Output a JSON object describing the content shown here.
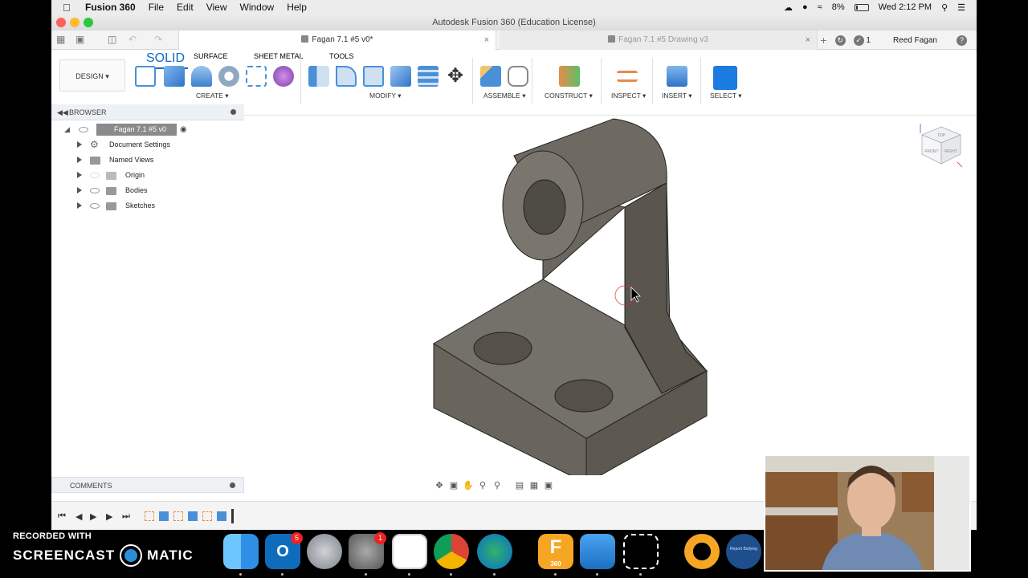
{
  "menubar": {
    "app": "Fusion 360",
    "items": [
      "File",
      "Edit",
      "View",
      "Window",
      "Help"
    ],
    "battery": "8%",
    "clock": "Wed 2:12 PM"
  },
  "window_title": "Autodesk Fusion 360 (Education License)",
  "tabs": {
    "active": "Fagan 7.1 #5 v0*",
    "inactive": "Fagan 7.1 #5 Drawing v3"
  },
  "user": {
    "job_count": "1",
    "name": "Reed Fagan",
    "help": "?"
  },
  "workspace": "DESIGN",
  "toolbar_tabs": [
    "SOLID",
    "SURFACE",
    "SHEET METAL",
    "TOOLS"
  ],
  "groups": [
    "CREATE",
    "MODIFY",
    "ASSEMBLE",
    "CONSTRUCT",
    "INSPECT",
    "INSERT",
    "SELECT"
  ],
  "browser": {
    "header": "BROWSER",
    "root": "Fagan 7.1 #5 v0",
    "items": [
      "Document Settings",
      "Named Views",
      "Origin",
      "Bodies",
      "Sketches"
    ]
  },
  "comments": "COMMENTS",
  "viewcube": {
    "top": "TOP",
    "front": "FRONT",
    "right": "RIGHT"
  },
  "watermark": {
    "line1": "RECORDED WITH",
    "line2a": "SCREENCAST",
    "line2b": "MATIC"
  },
  "dock": {
    "outlook_badge": "5",
    "prefs_badge": "1",
    "fusion_label": "360",
    "report_label": "Report Bullying"
  },
  "colors": {
    "accent": "#0a6cc9",
    "model": "#6b655a",
    "close": "#ff5f57",
    "min": "#febc2e",
    "max": "#28c840"
  }
}
